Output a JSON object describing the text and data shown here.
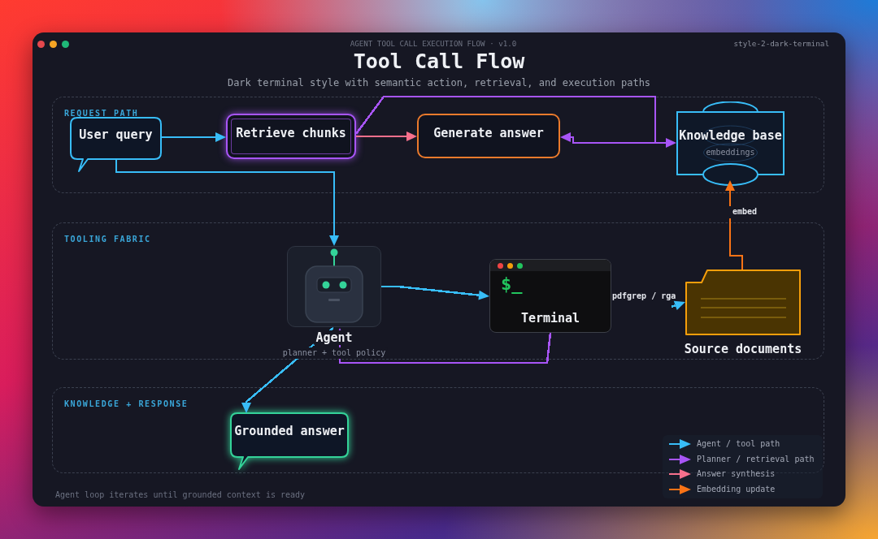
{
  "window": {
    "eyebrow": "AGENT TOOL CALL EXECUTION FLOW · v1.0",
    "tag": "style-2-dark-terminal",
    "title": "Tool Call Flow",
    "subtitle": "Dark terminal style with semantic action, retrieval, and execution paths"
  },
  "lanes": [
    {
      "label": "REQUEST PATH"
    },
    {
      "label": "TOOLING FABRIC"
    },
    {
      "label": "KNOWLEDGE + RESPONSE"
    }
  ],
  "nodes": [
    {
      "kind": "bubble",
      "label": "User query",
      "color": "#38bdf8",
      "highlighted": false
    },
    {
      "kind": "process",
      "label": "Retrieve chunks",
      "color": "#a855f7",
      "highlighted": true
    },
    {
      "kind": "process",
      "label": "Generate answer",
      "color": "#ea7a2c",
      "highlighted": false
    },
    {
      "kind": "database",
      "label": "Knowledge base",
      "sublabel": "embeddings",
      "color": "#38bdf8",
      "highlighted": false
    },
    {
      "kind": "agent",
      "label": "Agent",
      "sublabel": "planner + tool policy",
      "highlighted": false
    },
    {
      "kind": "terminal",
      "label": "Terminal",
      "prompt": "$_",
      "highlighted": false
    },
    {
      "kind": "folder",
      "label": "Source documents",
      "color": "#f59e0b",
      "highlighted": false
    },
    {
      "kind": "bubble",
      "label": "Grounded answer",
      "color": "#34d399",
      "highlighted": true
    }
  ],
  "edges": [
    {
      "color": "#38bdf8"
    },
    {
      "color": "#38bdf8"
    },
    {
      "color": "#f7708c"
    },
    {
      "color": "#a855f7"
    },
    {
      "color": "#a855f7"
    },
    {
      "color": "#38bdf8"
    },
    {
      "color": "#38bdf8",
      "label": "pdfgrep / rga"
    },
    {
      "color": "#a855f7"
    },
    {
      "color": "#38bdf8"
    },
    {
      "color": "#f97316",
      "label": "embed"
    }
  ],
  "legend": [
    {
      "label": "Agent / tool path",
      "color": "#38bdf8"
    },
    {
      "label": "Planner / retrieval path",
      "color": "#a855f7"
    },
    {
      "label": "Answer synthesis",
      "color": "#f7708c"
    },
    {
      "label": "Embedding update",
      "color": "#f97316"
    }
  ],
  "footer": "Agent loop iterates until grounded context is ready"
}
